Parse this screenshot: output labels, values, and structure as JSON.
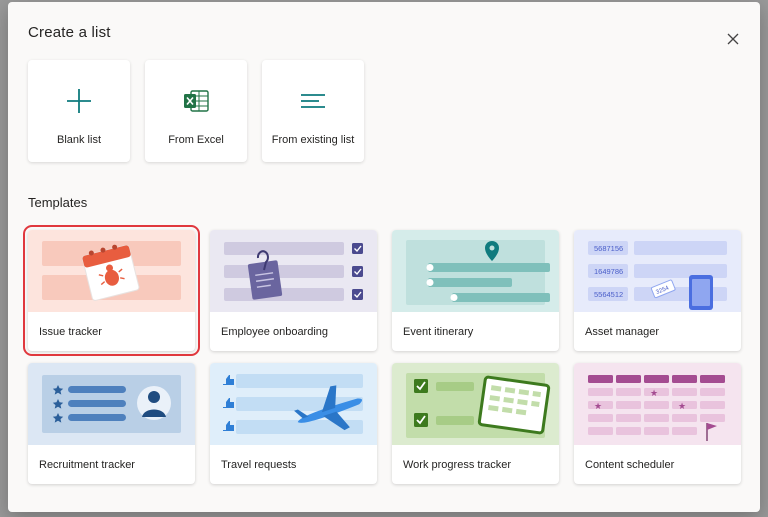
{
  "dialog": {
    "title": "Create a list",
    "close_icon": "close-icon"
  },
  "create_options": [
    {
      "label": "Blank list",
      "icon": "plus-icon"
    },
    {
      "label": "From Excel",
      "icon": "excel-icon"
    },
    {
      "label": "From existing list",
      "icon": "list-lines-icon"
    }
  ],
  "templates_section": {
    "title": "Templates",
    "selected": "Issue tracker",
    "items": [
      {
        "label": "Issue tracker"
      },
      {
        "label": "Employee onboarding"
      },
      {
        "label": "Event itinerary"
      },
      {
        "label": "Asset manager",
        "codes": [
          "5687156",
          "1649786",
          "5564512",
          "3254"
        ]
      },
      {
        "label": "Recruitment tracker"
      },
      {
        "label": "Travel requests"
      },
      {
        "label": "Work progress tracker"
      },
      {
        "label": "Content scheduler"
      }
    ]
  },
  "colors": {
    "accent_teal": "#0f7b7e",
    "excel_green": "#217346",
    "selection_red": "#e0383e"
  }
}
